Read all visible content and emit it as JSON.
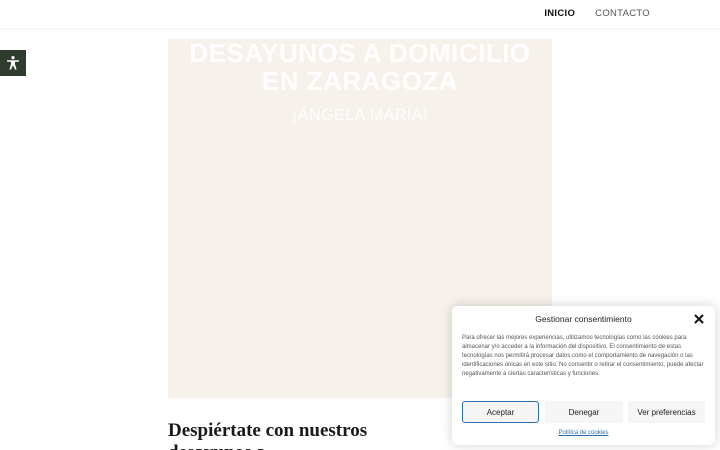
{
  "nav": {
    "items": [
      {
        "label": "INICIO",
        "active": true
      },
      {
        "label": "CONTACTO",
        "active": false
      }
    ]
  },
  "accessibility": {
    "icon": "accessibility-icon",
    "color": "#2f3b2e"
  },
  "hero": {
    "title": "DESAYUNOS A DOMICILIO EN ZARAGOZA",
    "subtitle": "¡ÁNGELA MARÍA!",
    "background": "#f6f1ea"
  },
  "section": {
    "heading": "Despiértate con nuestros desayunos a"
  },
  "cookie": {
    "title": "Gestionar consentimiento",
    "body": "Para ofrecer las mejores experiencias, utilizamos tecnologías como las cookies para almacenar y/o acceder a la información del dispositivo. El consentimiento de estas tecnologías nos permitirá procesar datos como el comportamiento de navegación o las identificaciones únicas en este sitio. No consentir o retirar el consentimiento, puede afectar negativamente a ciertas características y funciones.",
    "accept_label": "Aceptar",
    "deny_label": "Denegar",
    "prefs_label": "Ver preferencias",
    "policy_link": "Política de cookies",
    "accent": "#2d6fb5"
  }
}
